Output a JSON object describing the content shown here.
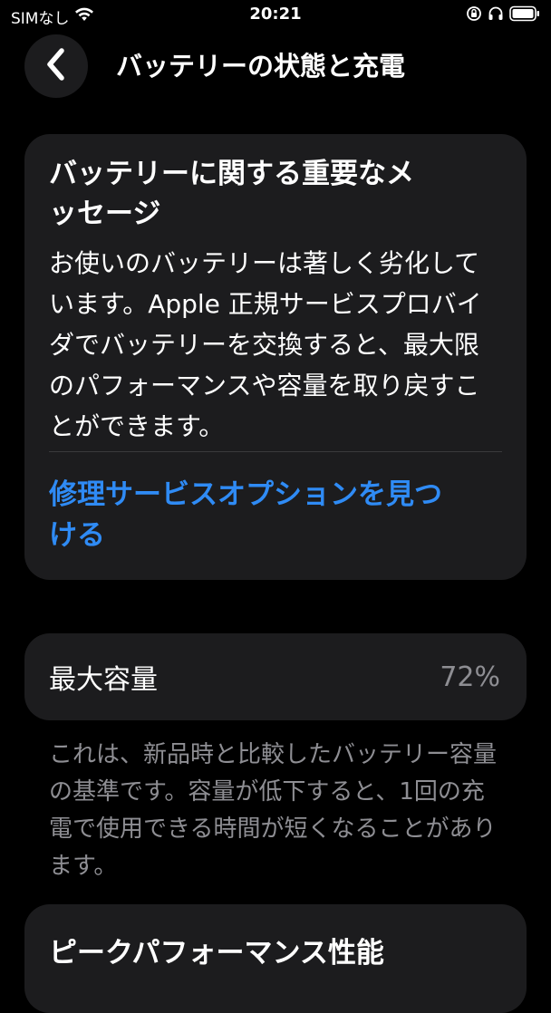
{
  "status_bar": {
    "carrier": "SIMなし",
    "time": "20:21"
  },
  "nav": {
    "title": "バッテリーの状態と充電"
  },
  "message_card": {
    "title": "バッテリーに関する重要なメッセージ",
    "body": "お使いのバッテリーは著しく劣化しています。Apple 正規サービスプロバイダでバッテリーを交換すると、最大限のパフォーマンスや容量を取り戻すことができます。",
    "link": "修理サービスオプションを見つける"
  },
  "capacity": {
    "label": "最大容量",
    "value": "72%",
    "description": "これは、新品時と比較したバッテリー容量の基準です。容量が低下すると、1回の充電で使用できる時間が短くなることがあります。"
  },
  "peak": {
    "title": "ピークパフォーマンス性能"
  },
  "colors": {
    "background": "#000000",
    "card": "#1c1c1e",
    "link": "#2f8bf5",
    "secondary_text": "#8e8e93"
  }
}
